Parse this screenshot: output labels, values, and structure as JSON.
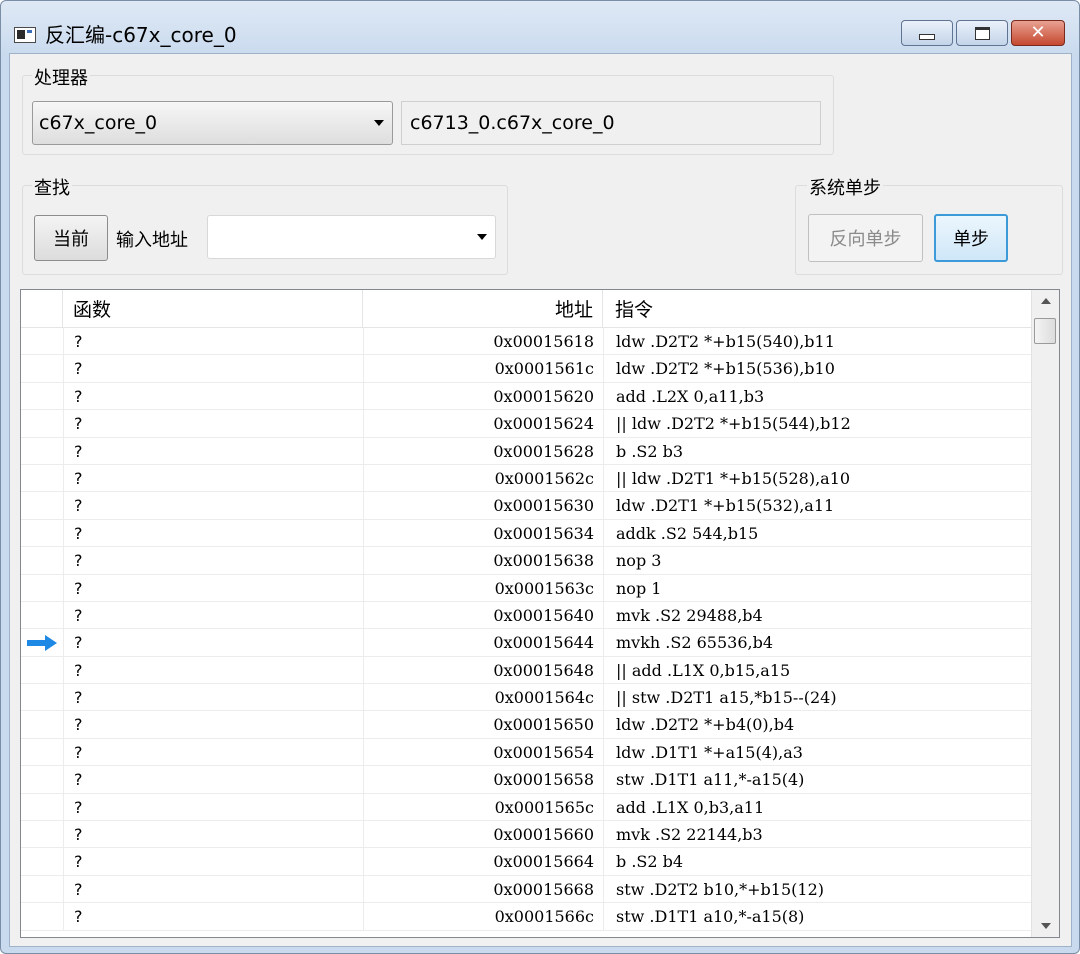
{
  "window": {
    "title": "反汇编-c67x_core_0",
    "close_glyph": "✕"
  },
  "processor": {
    "group_label": "处理器",
    "selected": "c67x_core_0",
    "full_name": "c6713_0.c67x_core_0"
  },
  "find": {
    "group_label": "查找",
    "current_button": "当前",
    "address_label": "输入地址",
    "address_value": ""
  },
  "step": {
    "group_label": "系统单步",
    "reverse_button": "反向单步",
    "step_button": "单步"
  },
  "table": {
    "columns": [
      "函数",
      "地址",
      "指令"
    ],
    "current_row_index": 11,
    "rows": [
      {
        "func": "?",
        "addr": "0x00015618",
        "instr": "ldw .D2T2 *+b15(540),b11"
      },
      {
        "func": "?",
        "addr": "0x0001561c",
        "instr": "ldw .D2T2 *+b15(536),b10"
      },
      {
        "func": "?",
        "addr": "0x00015620",
        "instr": "add .L2X 0,a11,b3"
      },
      {
        "func": "?",
        "addr": "0x00015624",
        "instr": "|| ldw .D2T2 *+b15(544),b12"
      },
      {
        "func": "?",
        "addr": "0x00015628",
        "instr": "b .S2 b3"
      },
      {
        "func": "?",
        "addr": "0x0001562c",
        "instr": "|| ldw .D2T1 *+b15(528),a10"
      },
      {
        "func": "?",
        "addr": "0x00015630",
        "instr": "ldw .D2T1 *+b15(532),a11"
      },
      {
        "func": "?",
        "addr": "0x00015634",
        "instr": "addk .S2 544,b15"
      },
      {
        "func": "?",
        "addr": "0x00015638",
        "instr": "nop 3"
      },
      {
        "func": "?",
        "addr": "0x0001563c",
        "instr": "nop 1"
      },
      {
        "func": "?",
        "addr": "0x00015640",
        "instr": "mvk .S2 29488,b4"
      },
      {
        "func": "?",
        "addr": "0x00015644",
        "instr": "mvkh .S2 65536,b4"
      },
      {
        "func": "?",
        "addr": "0x00015648",
        "instr": "|| add .L1X 0,b15,a15"
      },
      {
        "func": "?",
        "addr": "0x0001564c",
        "instr": "|| stw .D2T1 a15,*b15--(24)"
      },
      {
        "func": "?",
        "addr": "0x00015650",
        "instr": "ldw .D2T2 *+b4(0),b4"
      },
      {
        "func": "?",
        "addr": "0x00015654",
        "instr": "ldw .D1T1 *+a15(4),a3"
      },
      {
        "func": "?",
        "addr": "0x00015658",
        "instr": "stw .D1T1 a11,*-a15(4)"
      },
      {
        "func": "?",
        "addr": "0x0001565c",
        "instr": "add .L1X 0,b3,a11"
      },
      {
        "func": "?",
        "addr": "0x00015660",
        "instr": "mvk .S2 22144,b3"
      },
      {
        "func": "?",
        "addr": "0x00015664",
        "instr": "b .S2 b4"
      },
      {
        "func": "?",
        "addr": "0x00015668",
        "instr": "stw .D2T2 b10,*+b15(12)"
      },
      {
        "func": "?",
        "addr": "0x0001566c",
        "instr": "stw .D1T1 a10,*-a15(8)"
      }
    ]
  },
  "colors": {
    "pc_arrow": "#1e88e5",
    "default_button_border": "#3c9ad8"
  }
}
